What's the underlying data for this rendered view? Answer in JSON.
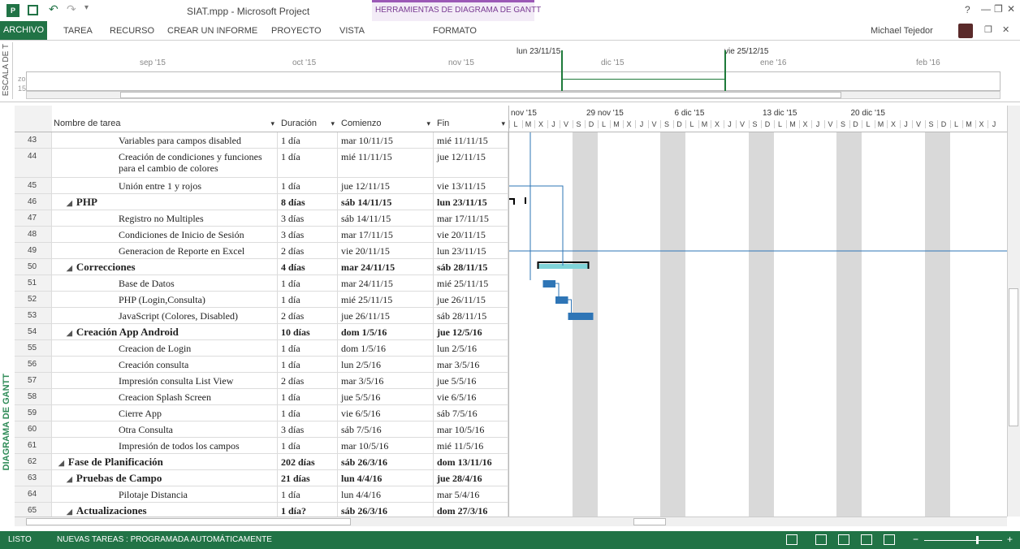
{
  "titlebar": {
    "doc_title": "SIAT.mpp - Microsoft Project",
    "contextual_group": "HERRAMIENTAS DE DIAGRAMA DE GANTT",
    "help": "?",
    "minimize": "—",
    "restore": "❐",
    "close": "✕"
  },
  "ribbon": {
    "tabs": [
      "ARCHIVO",
      "TAREA",
      "RECURSO",
      "CREAR UN INFORME",
      "PROYECTO",
      "VISTA",
      "FORMATO"
    ],
    "user": "Michael Tejedor"
  },
  "timeline": {
    "side_label": "ESCALA DE T",
    "zo_label": "zo",
    "num_label": "15",
    "months": [
      "sep '15",
      "oct '15",
      "nov '15",
      "dic '15",
      "ene '16",
      "feb '16"
    ],
    "markers": [
      "lun 23/11/15",
      "vie 25/12/15"
    ]
  },
  "view_side_label": "DIAGRAMA DE GANTT",
  "table": {
    "headers": {
      "name": "Nombre de tarea",
      "duration": "Duración",
      "start": "Comienzo",
      "end": "Fin"
    },
    "rows": [
      {
        "id": "43",
        "name": "Variables para campos disabled",
        "duration": "1 día",
        "start": "mar 10/11/15",
        "end": "mié 11/11/15",
        "level": 3,
        "summary": false
      },
      {
        "id": "44",
        "name": "Creación de condiciones y funciones para el cambio de colores",
        "duration": "1 día",
        "start": "mié 11/11/15",
        "end": "jue 12/11/15",
        "level": 3,
        "summary": false
      },
      {
        "id": "45",
        "name": "Unión entre 1 y rojos",
        "duration": "1 día",
        "start": "jue 12/11/15",
        "end": "vie 13/11/15",
        "level": 3,
        "summary": false
      },
      {
        "id": "46",
        "name": "PHP",
        "duration": "8 días",
        "start": "sáb 14/11/15",
        "end": "lun 23/11/15",
        "level": 2,
        "summary": true
      },
      {
        "id": "47",
        "name": "Registro no Multiples",
        "duration": "3 días",
        "start": "sáb 14/11/15",
        "end": "mar 17/11/15",
        "level": 3,
        "summary": false
      },
      {
        "id": "48",
        "name": "Condiciones de Inicio de Sesión",
        "duration": "3 días",
        "start": "mar 17/11/15",
        "end": "vie 20/11/15",
        "level": 3,
        "summary": false
      },
      {
        "id": "49",
        "name": "Generacion de Reporte en Excel",
        "duration": "2 días",
        "start": "vie 20/11/15",
        "end": "lun 23/11/15",
        "level": 3,
        "summary": false
      },
      {
        "id": "50",
        "name": "Correcciones",
        "duration": "4 días",
        "start": "mar 24/11/15",
        "end": "sáb 28/11/15",
        "level": 2,
        "summary": true
      },
      {
        "id": "51",
        "name": "Base de Datos",
        "duration": "1 día",
        "start": "mar 24/11/15",
        "end": "mié 25/11/15",
        "level": 3,
        "summary": false
      },
      {
        "id": "52",
        "name": "PHP (Login,Consulta)",
        "duration": "1 día",
        "start": "mié 25/11/15",
        "end": "jue 26/11/15",
        "level": 3,
        "summary": false
      },
      {
        "id": "53",
        "name": "JavaScript (Colores, Disabled)",
        "duration": "2 días",
        "start": "jue 26/11/15",
        "end": "sáb 28/11/15",
        "level": 3,
        "summary": false
      },
      {
        "id": "54",
        "name": "Creación App Android",
        "duration": "10 días",
        "start": "dom 1/5/16",
        "end": "jue 12/5/16",
        "level": 2,
        "summary": true
      },
      {
        "id": "55",
        "name": "Creacion de Login",
        "duration": "1 día",
        "start": "dom 1/5/16",
        "end": "lun 2/5/16",
        "level": 3,
        "summary": false
      },
      {
        "id": "56",
        "name": "Creación consulta",
        "duration": "1 día",
        "start": "lun 2/5/16",
        "end": "mar 3/5/16",
        "level": 3,
        "summary": false
      },
      {
        "id": "57",
        "name": "Impresión consulta List View",
        "duration": "2 días",
        "start": "mar 3/5/16",
        "end": "jue 5/5/16",
        "level": 3,
        "summary": false
      },
      {
        "id": "58",
        "name": "Creacion Splash Screen",
        "duration": "1 día",
        "start": "jue 5/5/16",
        "end": "vie 6/5/16",
        "level": 3,
        "summary": false
      },
      {
        "id": "59",
        "name": "Cierre App",
        "duration": "1 día",
        "start": "vie 6/5/16",
        "end": "sáb 7/5/16",
        "level": 3,
        "summary": false
      },
      {
        "id": "60",
        "name": "Otra Consulta",
        "duration": "3 días",
        "start": "sáb 7/5/16",
        "end": "mar 10/5/16",
        "level": 3,
        "summary": false
      },
      {
        "id": "61",
        "name": "Impresión de todos los campos",
        "duration": "1 día",
        "start": "mar 10/5/16",
        "end": "mié 11/5/16",
        "level": 3,
        "summary": false
      },
      {
        "id": "62",
        "name": "Fase de Planificación",
        "duration": "202 días",
        "start": "sáb 26/3/16",
        "end": "dom 13/11/16",
        "level": 1,
        "summary": true
      },
      {
        "id": "63",
        "name": "Pruebas de Campo",
        "duration": "21 días",
        "start": "lun 4/4/16",
        "end": "jue 28/4/16",
        "level": 2,
        "summary": true
      },
      {
        "id": "64",
        "name": "Pilotaje Distancia",
        "duration": "1 día",
        "start": "lun 4/4/16",
        "end": "mar 5/4/16",
        "level": 3,
        "summary": false
      },
      {
        "id": "65",
        "name": "Actualizaciones",
        "duration": "1 día?",
        "start": "sáb 26/3/16",
        "end": "dom 27/3/16",
        "level": 2,
        "summary": true
      }
    ]
  },
  "gantt": {
    "weeks": [
      "nov '15",
      "29 nov '15",
      "6 dic '15",
      "13 dic '15",
      "20 dic '15"
    ],
    "day_letters": [
      "L",
      "M",
      "X",
      "J",
      "V",
      "S",
      "D",
      "L",
      "M",
      "X",
      "J",
      "V",
      "S",
      "D",
      "L",
      "M",
      "X",
      "J",
      "V",
      "S",
      "D",
      "L",
      "M",
      "X",
      "J",
      "V",
      "S",
      "D",
      "L",
      "M",
      "X",
      "J",
      "V",
      "S",
      "D",
      "L",
      "M",
      "X",
      "J"
    ],
    "bar_color": "#2e75b6",
    "summary_color": "#7fd3d8"
  },
  "statusbar": {
    "ready": "LISTO",
    "new_tasks": "NUEVAS TAREAS : PROGRAMADA AUTOMÁTICAMENTE",
    "accent": "#217346"
  }
}
